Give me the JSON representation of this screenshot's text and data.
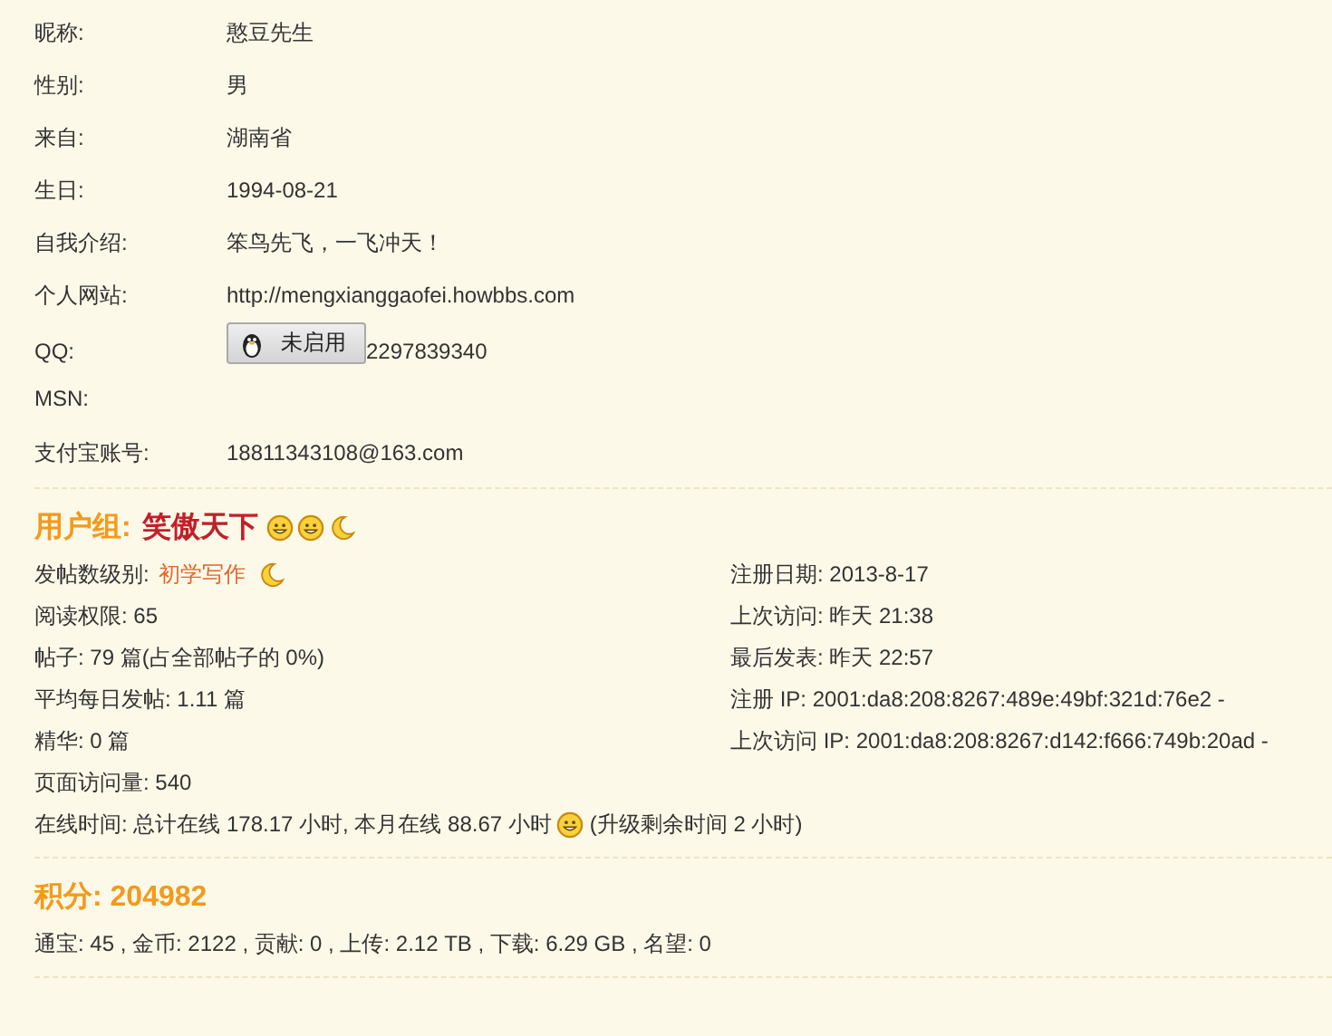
{
  "profile": [
    {
      "label": "昵称:",
      "value": "憨豆先生",
      "kind": "text"
    },
    {
      "label": "性别:",
      "value": "男",
      "kind": "text"
    },
    {
      "label": "来自:",
      "value": "湖南省",
      "kind": "text"
    },
    {
      "label": "生日:",
      "value": "1994-08-21",
      "kind": "text"
    },
    {
      "label": "自我介绍:",
      "value": "笨鸟先飞，一飞冲天！",
      "kind": "text"
    },
    {
      "label": "个人网站:",
      "value": "http://mengxianggaofei.howbbs.com",
      "kind": "text"
    },
    {
      "label": "QQ:",
      "button": "未启用",
      "value": "2297839340",
      "kind": "qq"
    },
    {
      "label": "MSN:",
      "kind": "text"
    },
    {
      "label": "支付宝账号:",
      "value": "18811343108@163.com",
      "kind": "text"
    }
  ],
  "group": {
    "label": "用户组:",
    "name": "笑傲天下",
    "badges": [
      {
        "kind": "smiley"
      },
      {
        "kind": "smiley"
      },
      {
        "kind": "moon"
      }
    ]
  },
  "stats_left": [
    {
      "kind": "rank",
      "label": "发帖数级别:",
      "value": "初学写作",
      "badges": [
        {
          "kind": "moon"
        }
      ]
    },
    {
      "kind": "text",
      "text": "阅读权限: 65"
    },
    {
      "kind": "text",
      "text": "帖子: 79 篇(占全部帖子的 0%)"
    },
    {
      "kind": "text",
      "text": "平均每日发帖: 1.11 篇"
    },
    {
      "kind": "text",
      "text": "精华: 0 篇"
    },
    {
      "kind": "text",
      "text": "页面访问量: 540"
    }
  ],
  "stats_right": [
    "注册日期: 2013-8-17",
    "上次访问: 昨天 21:38",
    "最后发表: 昨天 22:57",
    "注册 IP: 2001:da8:208:8267:489e:49bf:321d:76e2 -",
    "上次访问 IP: 2001:da8:208:8267:d142:f666:749b:20ad -"
  ],
  "online": {
    "text": "在线时间: 总计在线 178.17 小时, 本月在线 88.67 小时",
    "badges": [
      {
        "kind": "smiley"
      }
    ],
    "note": "(升级剩余时间 2 小时)"
  },
  "credits": {
    "title": "积分: 204982",
    "details": "通宝: 45 , 金币: 2122 , 贡献: 0 , 上传: 2.12 TB , 下载: 6.29 GB , 名望: 0"
  }
}
